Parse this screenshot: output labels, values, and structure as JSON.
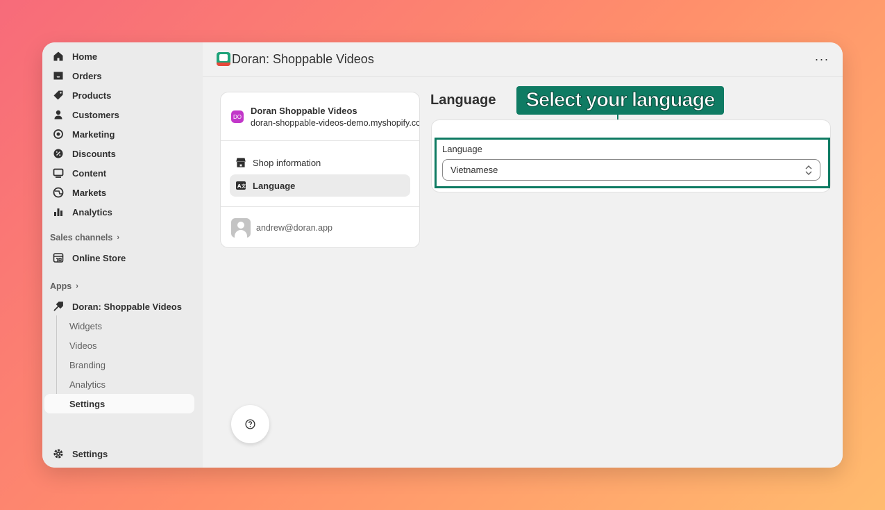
{
  "sidebar": {
    "items": [
      {
        "label": "Home",
        "icon": "home-icon"
      },
      {
        "label": "Orders",
        "icon": "inbox-icon"
      },
      {
        "label": "Products",
        "icon": "tag-icon"
      },
      {
        "label": "Customers",
        "icon": "person-icon"
      },
      {
        "label": "Marketing",
        "icon": "target-icon"
      },
      {
        "label": "Discounts",
        "icon": "discount-icon"
      },
      {
        "label": "Content",
        "icon": "content-icon"
      },
      {
        "label": "Markets",
        "icon": "globe-icon"
      },
      {
        "label": "Analytics",
        "icon": "bar-chart-icon"
      }
    ],
    "sales_channels_label": "Sales channels",
    "online_store_label": "Online Store",
    "apps_label": "Apps",
    "app_name": "Doran: Shoppable Videos",
    "app_sub_items": [
      "Widgets",
      "Videos",
      "Branding",
      "Analytics",
      "Settings"
    ],
    "settings_label": "Settings"
  },
  "topbar": {
    "title": "Doran: Shoppable Videos",
    "more_label": "···"
  },
  "shop_card": {
    "badge": "DO",
    "name": "Doran Shoppable Videos",
    "domain": "doran-shoppable-videos-demo.myshopify.com",
    "menu": [
      "Shop information",
      "Language"
    ],
    "user_email": "andrew@doran.app"
  },
  "language_section": {
    "title": "Language",
    "callout": "Select your language",
    "field_label": "Language",
    "selected": "Vietnamese"
  },
  "colors": {
    "accent": "#0f7b63",
    "shop_badge": "#c237c9"
  }
}
